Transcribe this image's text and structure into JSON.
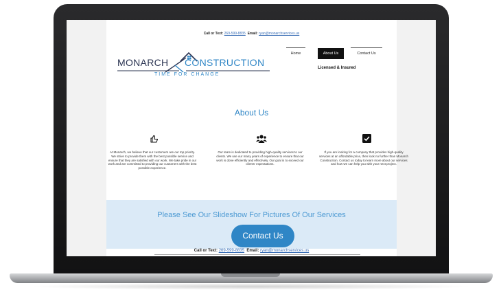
{
  "header": {
    "call_label": "Call or Text:",
    "phone": "269-599-8835",
    "email_label": "Email:",
    "email": "ryan@monarchservices.us"
  },
  "logo": {
    "left_word": "MONARCH",
    "right_word": "CONSTRUCTION",
    "tagline": "TIME FOR CHANGE"
  },
  "nav": {
    "items": [
      {
        "label": "Home"
      },
      {
        "label": "About Us",
        "active": true
      },
      {
        "label": "Contact Us"
      }
    ],
    "licensed": "Licensed & Insured"
  },
  "about": {
    "title": "About Us",
    "columns": [
      {
        "icon": "thumbs-up-icon",
        "text": "At Monarch, we believe that our customers are our top priority. We strive to provide them with the best possible service and ensure that they are satisfied with our work. We take pride in our work and are committed to providing our customers with the best possible experience."
      },
      {
        "icon": "users-icon",
        "text": "Our team is dedicated to providing high-quality services to our clients. We use our many years of experience to ensure that our work is done efficiently and effectively. Our goal is to exceed our clients' expectations."
      },
      {
        "icon": "checkbox-icon",
        "text": "If you are looking for a company that provides high-quality services at an affordable price, then look no further than Monarch Construction. Contact us today to learn more about our services and how we can help you with your next project."
      }
    ]
  },
  "banner": {
    "text": "Please See Our Slideshow For Pictures Of Our Services",
    "button_label": "Contact Us"
  },
  "footer": {
    "call_label": "Call or Text:",
    "phone": "269-599-8835",
    "email_label": "Email:",
    "email": "ryan@monarchservices.us"
  },
  "colors": {
    "brand_blue": "#2f86c6",
    "brand_navy": "#2b3452",
    "banner_bg": "#dbeaf7"
  }
}
